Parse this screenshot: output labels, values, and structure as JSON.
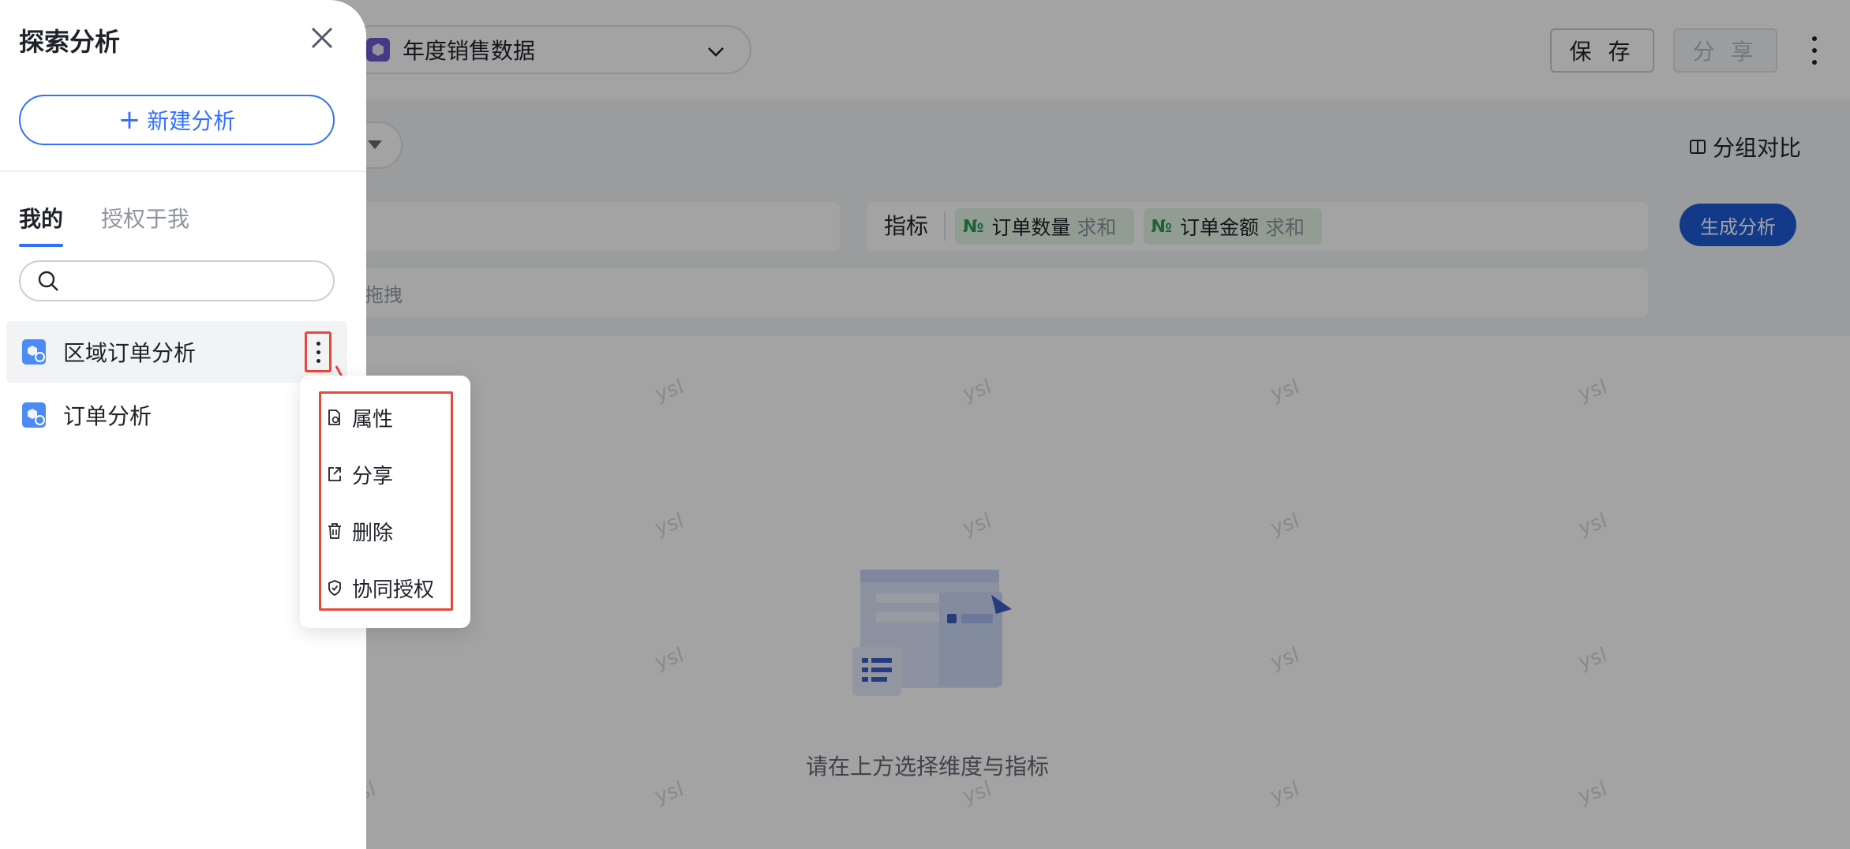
{
  "header": {
    "dataset_name": "年度销售数据",
    "save_label": "保 存",
    "share_label": "分 享"
  },
  "config": {
    "group_compare_label": "分组对比",
    "metric_label": "指标",
    "metrics": [
      {
        "type_badge": "№",
        "name": "订单数量",
        "aggregation": "求和"
      },
      {
        "type_badge": "№",
        "name": "订单金额",
        "aggregation": "求和"
      }
    ],
    "generate_label": "生成分析",
    "filter_hint": "拖拽"
  },
  "empty_state": {
    "message": "请在上方选择维度与指标"
  },
  "watermark": "ysl",
  "drawer": {
    "title": "探索分析",
    "new_analysis_label": "新建分析",
    "new_analysis_plus": "+",
    "tabs": [
      {
        "label": "我的",
        "active": true
      },
      {
        "label": "授权于我",
        "active": false
      }
    ],
    "search_placeholder": "",
    "items": [
      {
        "name": "区域订单分析",
        "selected": true
      },
      {
        "name": "订单分析",
        "selected": false
      }
    ]
  },
  "context_menu": {
    "items": [
      {
        "label": "属性",
        "icon": "properties-icon"
      },
      {
        "label": "分享",
        "icon": "share-icon"
      },
      {
        "label": "删除",
        "icon": "trash-icon"
      },
      {
        "label": "协同授权",
        "icon": "shield-icon"
      }
    ]
  },
  "colors": {
    "primary": "#3370ff",
    "generate_button": "#1d5bd6",
    "highlight_red": "#e5483c",
    "metric_tag_bg": "#e3f4e7"
  }
}
